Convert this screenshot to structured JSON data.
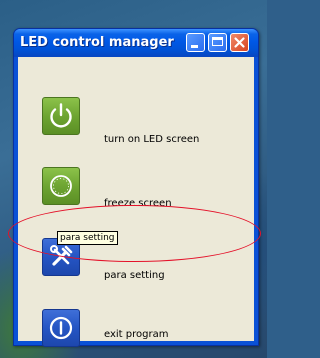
{
  "window": {
    "title": "LED control manager",
    "title_buttons": [
      "minimize",
      "maximize",
      "close"
    ]
  },
  "items": [
    {
      "icon": "power-icon",
      "label": "turn on LED screen",
      "color": "#6ea532"
    },
    {
      "icon": "freeze-icon",
      "label": "freeze screen",
      "color": "#6ea532"
    },
    {
      "icon": "tools-icon",
      "label": "para setting",
      "color": "#2555c4"
    },
    {
      "icon": "exit-icon",
      "label": "exit program",
      "color": "#2555c4"
    }
  ],
  "tooltip": {
    "text": "para setting"
  },
  "annotation": {
    "shape": "ellipse",
    "color": "#e4122a",
    "target": "para setting"
  }
}
